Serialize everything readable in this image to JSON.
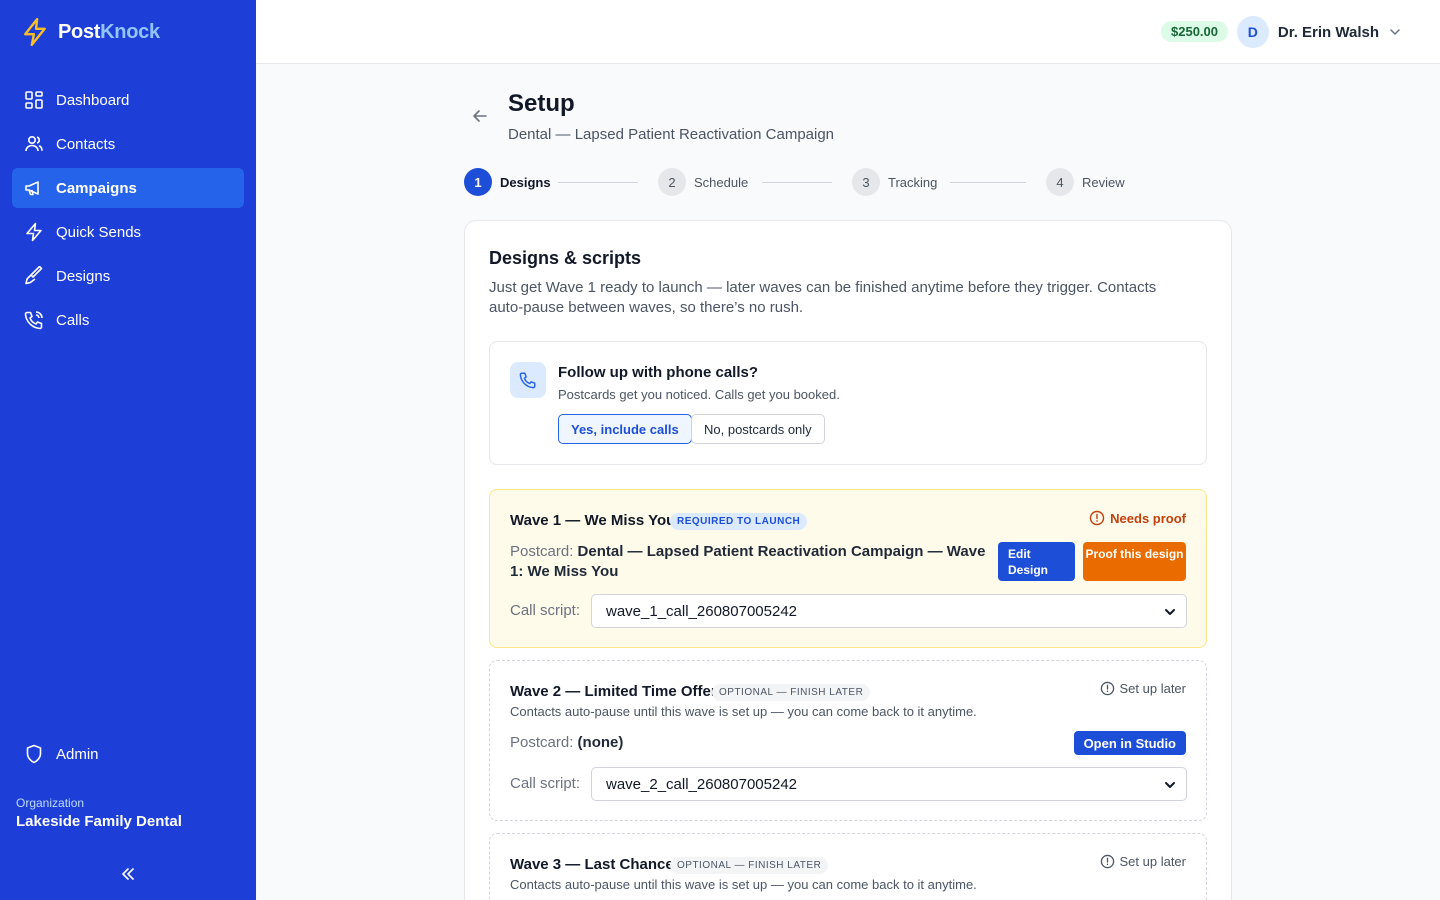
{
  "brand": {
    "name_part1": "Post",
    "name_part2": "Knock"
  },
  "sidebar": {
    "items": [
      {
        "label": "Dashboard",
        "icon": "dashboard-icon"
      },
      {
        "label": "Contacts",
        "icon": "users-icon"
      },
      {
        "label": "Campaigns",
        "icon": "megaphone-icon",
        "active": true
      },
      {
        "label": "Quick Sends",
        "icon": "bolt-icon"
      },
      {
        "label": "Designs",
        "icon": "brush-icon"
      },
      {
        "label": "Calls",
        "icon": "phone-icon"
      }
    ],
    "admin_label": "Admin",
    "org_label": "Organization",
    "org_name": "Lakeside Family Dental"
  },
  "topbar": {
    "balance": "$250.00",
    "avatar_initial": "D",
    "user_name": "Dr. Erin Walsh"
  },
  "page": {
    "title": "Setup",
    "subtitle": "Dental — Lapsed Patient Reactivation Campaign"
  },
  "steps": [
    {
      "num": "1",
      "label": "Designs"
    },
    {
      "num": "2",
      "label": "Schedule"
    },
    {
      "num": "3",
      "label": "Tracking"
    },
    {
      "num": "4",
      "label": "Review"
    }
  ],
  "card": {
    "title": "Designs & scripts",
    "description": "Just get Wave 1 ready to launch — later waves can be finished anytime before they trigger. Contacts auto-pause between waves, so there’s no rush."
  },
  "calls": {
    "title": "Follow up with phone calls?",
    "subtitle": "Postcards get you noticed. Calls get you booked.",
    "yes_label": "Yes, include calls",
    "no_label": "No, postcards only"
  },
  "waves": [
    {
      "title": "Wave 1 — We Miss You",
      "badge": "REQUIRED TO LAUNCH",
      "status": "Needs proof",
      "postcard_label": "Postcard:",
      "postcard_value": "Dental — Lapsed Patient Reactivation Campaign — Wave 1: We Miss You",
      "edit_label": "Edit Design",
      "proof_label": "Proof this design",
      "script_label": "Call script:",
      "script_value": "wave_1_call_260807005242"
    },
    {
      "title": "Wave 2 — Limited Time Offer",
      "badge": "OPTIONAL — FINISH LATER",
      "status": "Set up later",
      "note": "Contacts auto-pause until this wave is set up — you can come back to it anytime.",
      "postcard_label": "Postcard:",
      "postcard_value": "(none)",
      "studio_label": "Open in Studio",
      "script_label": "Call script:",
      "script_value": "wave_2_call_260807005242"
    },
    {
      "title": "Wave 3 — Last Chance",
      "badge": "OPTIONAL — FINISH LATER",
      "status": "Set up later",
      "note": "Contacts auto-pause until this wave is set up — you can come back to it anytime."
    }
  ],
  "colors": {
    "sidebar": "#1d3fd8",
    "accent": "#1d4ed8",
    "proof": "#ea6c00",
    "balance_bg": "#dcfce7"
  }
}
